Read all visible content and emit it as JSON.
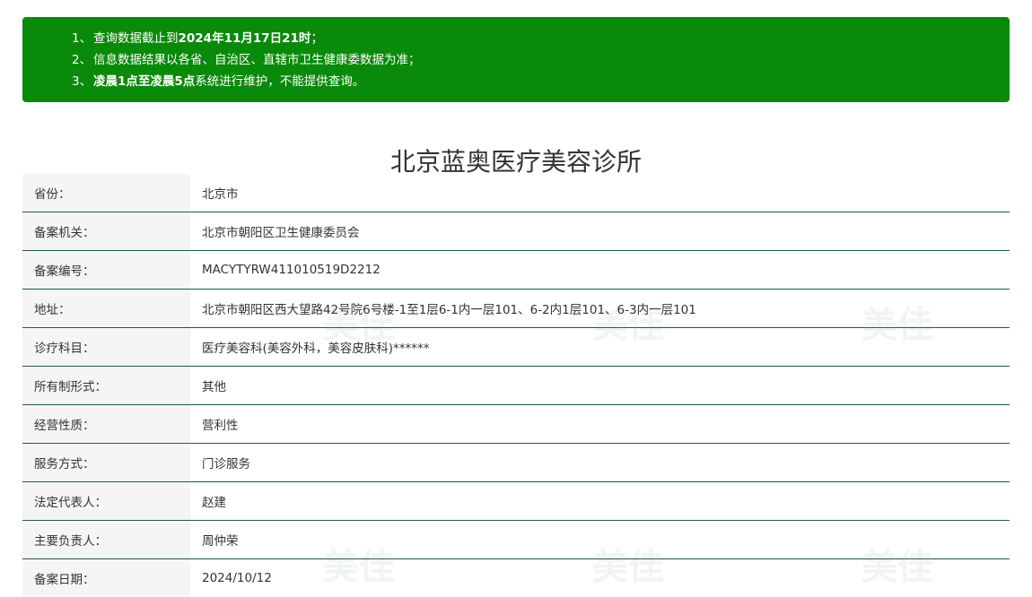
{
  "notice": {
    "items": [
      {
        "num": "1、",
        "pre": "查询数据截止到",
        "bold": "2024年11月17日21时",
        "post": "；"
      },
      {
        "num": "2、",
        "pre": "信息数据结果以各省、自治区、直辖市卫生健康委数据为准；",
        "bold": "",
        "post": ""
      },
      {
        "num": "3、",
        "pre": "",
        "bold": "凌晨1点至凌晨5点",
        "post": "系统进行维护，不能提供查询。"
      }
    ]
  },
  "title": "北京蓝奥医疗美容诊所",
  "rows": [
    {
      "label": "省份：",
      "value": "北京市"
    },
    {
      "label": "备案机关：",
      "value": "北京市朝阳区卫生健康委员会"
    },
    {
      "label": "备案编号：",
      "value": "MACYTYRW411010519D2212"
    },
    {
      "label": "地址：",
      "value": "北京市朝阳区西大望路42号院6号楼-1至1层6-1内一层101、6-2内1层101、6-3内一层101"
    },
    {
      "label": "诊疗科目：",
      "value": "医疗美容科(美容外科，美容皮肤科)******"
    },
    {
      "label": "所有制形式：",
      "value": "其他"
    },
    {
      "label": "经营性质：",
      "value": "营利性"
    },
    {
      "label": "服务方式：",
      "value": "门诊服务"
    },
    {
      "label": "法定代表人：",
      "value": "赵建"
    },
    {
      "label": "主要负责人：",
      "value": "周仲荣"
    },
    {
      "label": "备案日期：",
      "value": "2024/10/12"
    }
  ],
  "watermark_text": "美佳",
  "colors": {
    "notice_bg": "#0a8a0a",
    "row_border": "#1f5a4a",
    "label_bg": "#f5f5f5"
  }
}
